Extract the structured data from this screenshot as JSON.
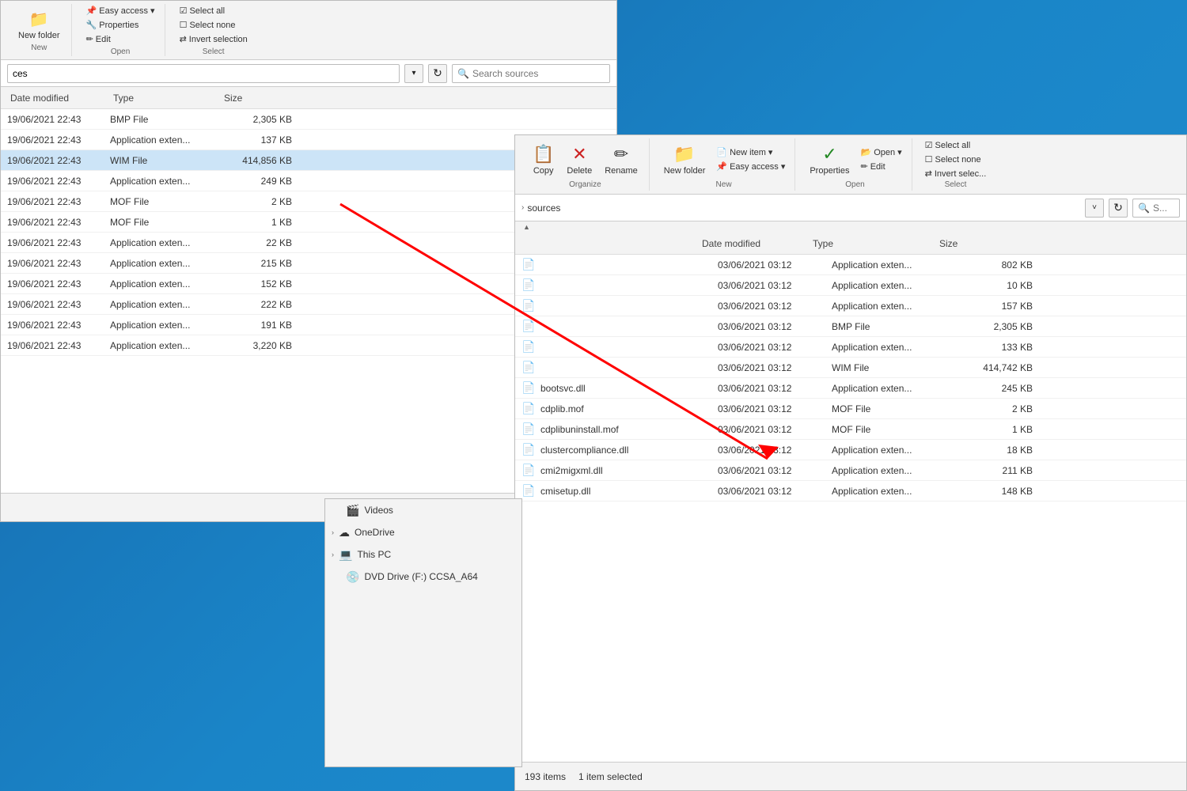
{
  "desktop": {
    "background": "blue gradient"
  },
  "left_panel": {
    "toolbar": {
      "new_folder_label": "New folder",
      "easy_access_label": "Easy access",
      "properties_label": "Properties",
      "edit_label": "Edit",
      "select_all_label": "Select all",
      "select_none_label": "Select none",
      "invert_selection_label": "Invert selection",
      "group_new": "New",
      "group_open": "Open",
      "group_select": "Select"
    },
    "address_bar": {
      "path": "ces",
      "search_placeholder": "Search sources"
    },
    "columns": {
      "date_modified": "Date modified",
      "type": "Type",
      "size": "Size"
    },
    "files": [
      {
        "date": "19/06/2021 22:43",
        "type": "BMP File",
        "size": "2,305 KB"
      },
      {
        "date": "19/06/2021 22:43",
        "type": "Application exten...",
        "size": "137 KB"
      },
      {
        "date": "19/06/2021 22:43",
        "type": "WIM File",
        "size": "414,856 KB",
        "selected": true
      },
      {
        "date": "19/06/2021 22:43",
        "type": "Application exten...",
        "size": "249 KB"
      },
      {
        "date": "19/06/2021 22:43",
        "type": "MOF File",
        "size": "2 KB"
      },
      {
        "date": "19/06/2021 22:43",
        "type": "MOF File",
        "size": "1 KB"
      },
      {
        "date": "19/06/2021 22:43",
        "type": "Application exten...",
        "size": "22 KB"
      },
      {
        "date": "19/06/2021 22:43",
        "type": "Application exten...",
        "size": "215 KB"
      },
      {
        "date": "19/06/2021 22:43",
        "type": "Application exten...",
        "size": "152 KB"
      },
      {
        "date": "19/06/2021 22:43",
        "type": "Application exten...",
        "size": "222 KB"
      },
      {
        "date": "19/06/2021 22:43",
        "type": "Application exten...",
        "size": "191 KB"
      },
      {
        "date": "19/06/2021 22:43",
        "type": "Application exten...",
        "size": "3,220 KB"
      }
    ],
    "view_list_icon": "≡",
    "view_grid_icon": "⊞"
  },
  "right_panel": {
    "toolbar": {
      "copy_label": "Copy",
      "delete_label": "Delete",
      "rename_label": "Rename",
      "new_item_label": "New item",
      "easy_access_label": "Easy access",
      "new_folder_label": "New folder",
      "open_label": "Open",
      "edit_label": "Edit",
      "properties_label": "Properties",
      "select_all_label": "Select all",
      "select_none_label": "Select none",
      "invert_selection_label": "Invert selec...",
      "group_organize": "Organize",
      "group_new": "New",
      "group_open": "Open",
      "group_select": "Select"
    },
    "breadcrumb": {
      "arrow": "›",
      "path": "sources",
      "dropdown_arrow": "˅",
      "refresh": "↻",
      "search_placeholder": "S..."
    },
    "columns": {
      "sort_asc": "^",
      "date_modified": "Date modified",
      "type": "Type",
      "size": "Size"
    },
    "files": [
      {
        "icon": "📄",
        "name": "",
        "date": "03/06/2021 03:12",
        "type": "Application exten...",
        "size": "802 KB"
      },
      {
        "icon": "📄",
        "name": "",
        "date": "03/06/2021 03:12",
        "type": "Application exten...",
        "size": "10 KB"
      },
      {
        "icon": "📄",
        "name": "",
        "date": "03/06/2021 03:12",
        "type": "Application exten...",
        "size": "157 KB"
      },
      {
        "icon": "📄",
        "name": "",
        "date": "03/06/2021 03:12",
        "type": "BMP File",
        "size": "2,305 KB"
      },
      {
        "icon": "📄",
        "name": "",
        "date": "03/06/2021 03:12",
        "type": "Application exten...",
        "size": "133 KB"
      },
      {
        "icon": "📄",
        "name": "",
        "date": "03/06/2021 03:12",
        "type": "WIM File",
        "size": "414,742 KB"
      },
      {
        "icon": "📄",
        "name": "bootsvc.dll",
        "date": "03/06/2021 03:12",
        "type": "Application exten...",
        "size": "245 KB"
      },
      {
        "icon": "📄",
        "name": "cdplib.mof",
        "date": "03/06/2021 03:12",
        "type": "MOF File",
        "size": "2 KB"
      },
      {
        "icon": "📄",
        "name": "cdplibuninstall.mof",
        "date": "03/06/2021 03:12",
        "type": "MOF File",
        "size": "1 KB"
      },
      {
        "icon": "📄",
        "name": "clustercompliance.dll",
        "date": "03/06/2021 03:12",
        "type": "Application exten...",
        "size": "18 KB"
      },
      {
        "icon": "📄",
        "name": "cmi2migxml.dll",
        "date": "03/06/2021 03:12",
        "type": "Application exten...",
        "size": "211 KB"
      },
      {
        "icon": "📄",
        "name": "cmisetup.dll",
        "date": "03/06/2021 03:12",
        "type": "Application exten...",
        "size": "148 KB"
      }
    ],
    "status": {
      "item_count": "193 items",
      "selected": "1 item selected"
    }
  },
  "sidebar": {
    "items": [
      {
        "icon": "🎬",
        "label": "Videos",
        "expandable": false
      },
      {
        "icon": "☁",
        "label": "OneDrive",
        "expandable": true
      },
      {
        "icon": "💻",
        "label": "This PC",
        "expandable": true
      },
      {
        "icon": "💿",
        "label": "DVD Drive (F:) CCSA_A64",
        "expandable": false
      }
    ]
  }
}
